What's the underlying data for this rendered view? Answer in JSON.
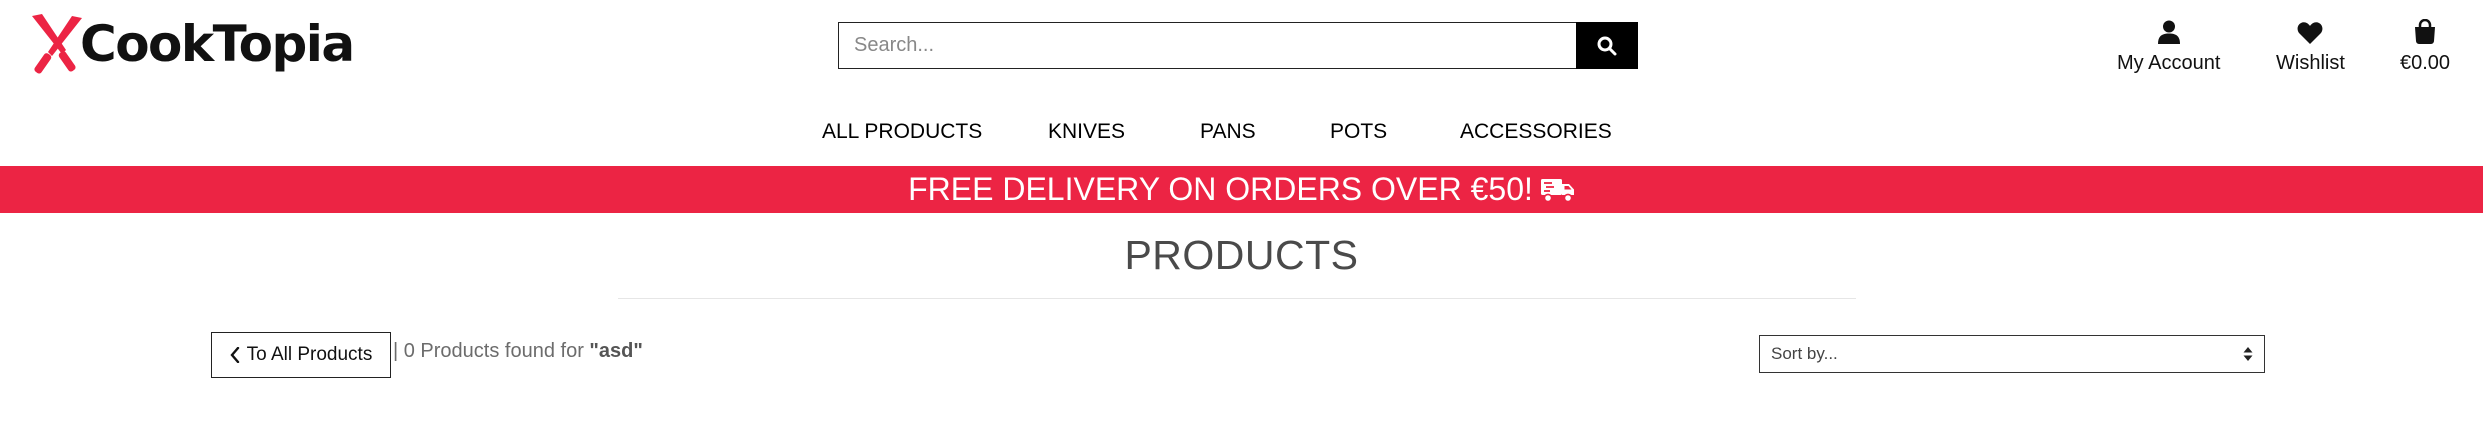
{
  "brand": {
    "name": "CookTopia",
    "accent": "#ec2444"
  },
  "search": {
    "placeholder": "Search...",
    "value": "",
    "icon": "search-icon"
  },
  "header_links": {
    "account": {
      "label": "My Account",
      "icon": "user-icon"
    },
    "wishlist": {
      "label": "Wishlist",
      "icon": "heart-icon"
    },
    "bag": {
      "label": "€0.00",
      "icon": "shopping-bag-icon"
    }
  },
  "nav": {
    "items": [
      {
        "label": "ALL PRODUCTS"
      },
      {
        "label": "KNIVES"
      },
      {
        "label": "PANS"
      },
      {
        "label": "POTS"
      },
      {
        "label": "ACCESSORIES"
      }
    ]
  },
  "banner": {
    "text": "FREE DELIVERY ON ORDERS OVER €50!",
    "icon": "delivery-truck-icon",
    "bg_color": "#ec2444"
  },
  "page": {
    "title": "PRODUCTS"
  },
  "results": {
    "back_label": "To All Products",
    "count_text": "| 0 Products found for",
    "query": "\"asd\""
  },
  "sort": {
    "selected": "Sort by...",
    "icon": "sort-arrows-icon"
  }
}
